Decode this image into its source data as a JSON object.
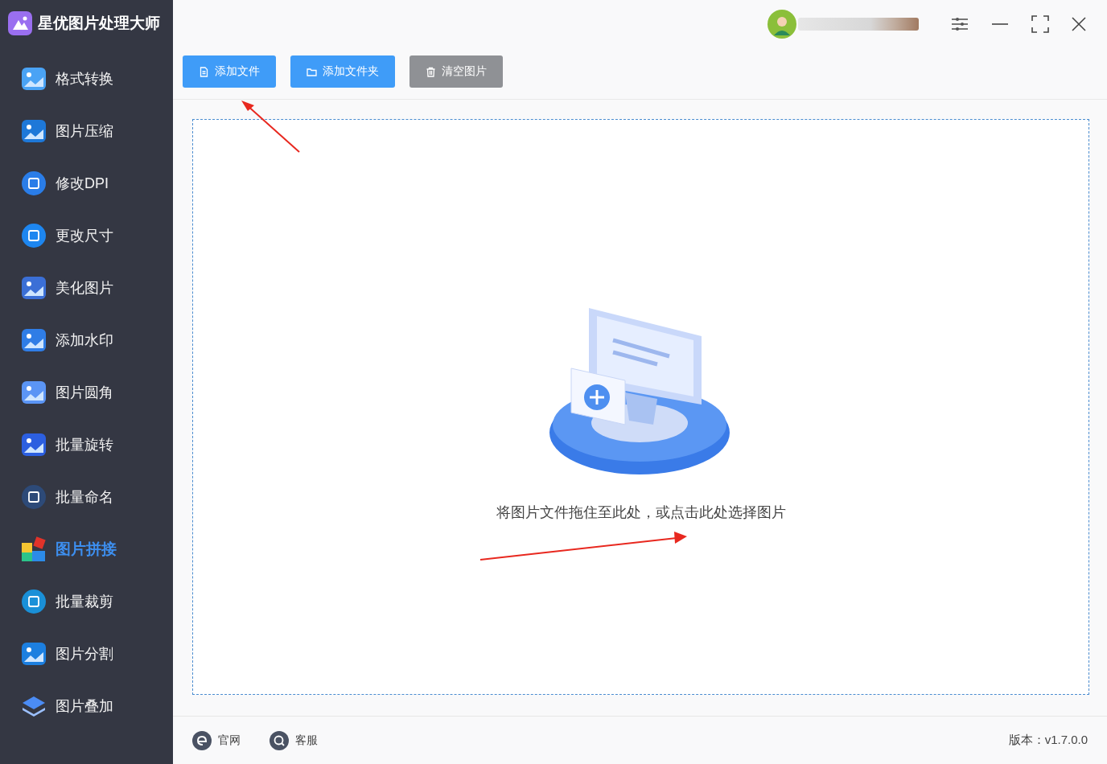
{
  "app": {
    "title": "星优图片处理大师"
  },
  "sidebar": {
    "items": [
      {
        "label": "格式转换",
        "kind": "photo",
        "selected": false
      },
      {
        "label": "图片压缩",
        "kind": "compress",
        "selected": false
      },
      {
        "label": "修改DPI",
        "kind": "dpi",
        "selected": false
      },
      {
        "label": "更改尺寸",
        "kind": "resize",
        "selected": false
      },
      {
        "label": "美化图片",
        "kind": "beautify",
        "selected": false
      },
      {
        "label": "添加水印",
        "kind": "watermark",
        "selected": false
      },
      {
        "label": "图片圆角",
        "kind": "corner",
        "selected": false
      },
      {
        "label": "批量旋转",
        "kind": "rotate",
        "selected": false
      },
      {
        "label": "批量命名",
        "kind": "rename",
        "selected": false
      },
      {
        "label": "图片拼接",
        "kind": "puzzle",
        "selected": true
      },
      {
        "label": "批量裁剪",
        "kind": "crop",
        "selected": false
      },
      {
        "label": "图片分割",
        "kind": "split",
        "selected": false
      },
      {
        "label": "图片叠加",
        "kind": "layers",
        "selected": false
      }
    ]
  },
  "toolbar": {
    "buttons": [
      {
        "label": "添加文件",
        "kind": "file"
      },
      {
        "label": "添加文件夹",
        "kind": "folder"
      },
      {
        "label": "清空图片",
        "kind": "clear"
      }
    ]
  },
  "drop_area": {
    "hint": "将图片文件拖住至此处，或点击此处选择图片"
  },
  "footer": {
    "links": [
      {
        "label": "官网",
        "kind": "web"
      },
      {
        "label": "客服",
        "kind": "chat"
      }
    ],
    "version": "版本：v1.7.0.0"
  }
}
